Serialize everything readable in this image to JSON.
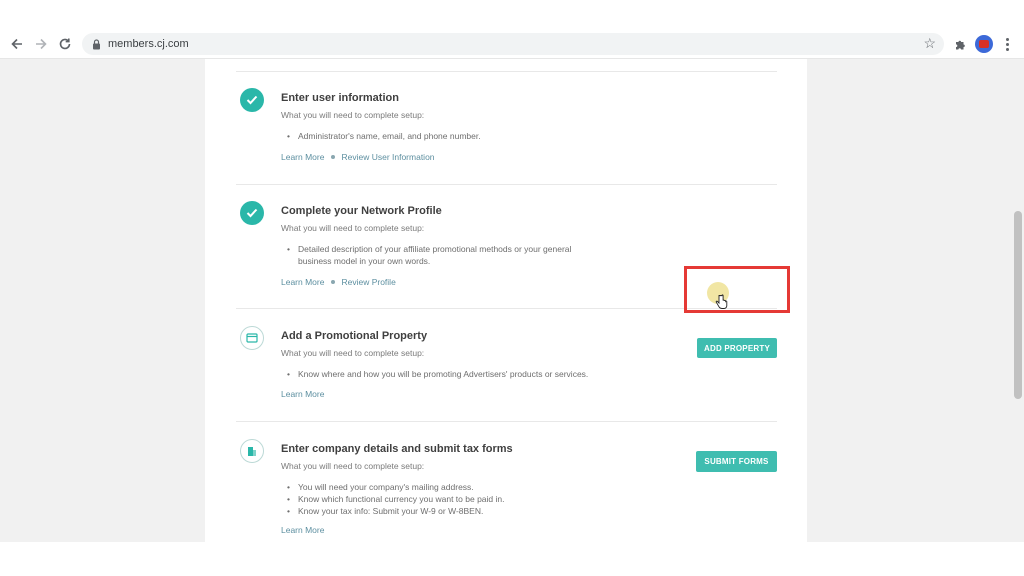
{
  "browser": {
    "url": "members.cj.com",
    "icons": [
      "back-arrow-icon",
      "forward-arrow-icon",
      "reload-icon",
      "lock-icon",
      "bookmark-star-icon",
      "extensions-puzzle-icon",
      "profile-avatar",
      "more-menu-icon"
    ]
  },
  "steps": [
    {
      "title": "Enter user information",
      "subtitle": "What you will need to complete setup:",
      "bullets": [
        "Administrator's name, email, and phone number."
      ],
      "links": [
        "Learn More",
        "Review User Information"
      ],
      "status": "completed"
    },
    {
      "title": "Complete your Network Profile",
      "subtitle": "What you will need to complete setup:",
      "bullets": [
        "Detailed description of your affiliate promotional methods or your general",
        "business model in your own words."
      ],
      "links": [
        "Learn More",
        "Review Profile"
      ],
      "status": "completed"
    },
    {
      "title": "Add a Promotional Property",
      "subtitle": "What you will need to complete setup:",
      "bullets": [
        "Know where and how you will be promoting Advertisers' products or services."
      ],
      "links": [
        "Learn More"
      ],
      "button": "ADD PROPERTY",
      "status": "pending"
    },
    {
      "title": "Enter company details and submit tax forms",
      "subtitle": "What you will need to complete setup:",
      "bullets": [
        "You will need your company's mailing address.",
        "Know which functional currency you want to be paid in.",
        "Know your tax info: Submit your W-9 or W-8BEN."
      ],
      "links": [
        "Learn More"
      ],
      "button": "SUBMIT FORMS",
      "status": "pending"
    }
  ],
  "colors": {
    "accent": "#3fbdb0",
    "check": "#2ab7a9",
    "link": "#5d8fa0",
    "highlight": "#e53935"
  }
}
